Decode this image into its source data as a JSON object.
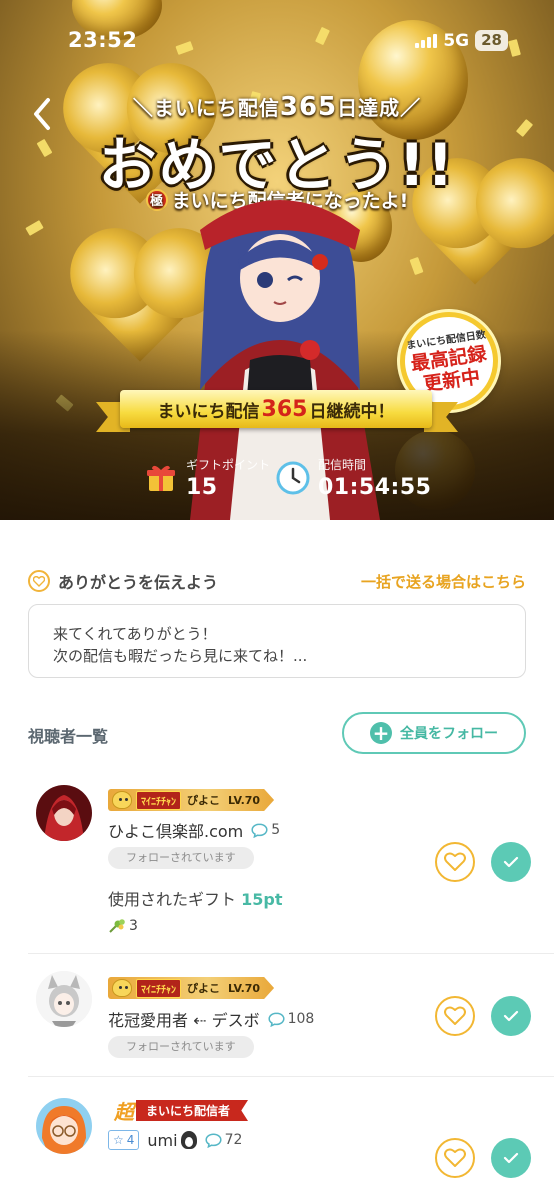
{
  "status_bar": {
    "time": "23:52",
    "network": "5G",
    "battery": "28"
  },
  "hero": {
    "top_line_prefix": "＼まいにち配信",
    "top_line_number": "365",
    "top_line_suffix": "日達成／",
    "title": "おめでとう!!",
    "subtitle_badge": "極",
    "subtitle": "極まいにち配信者になったよ!",
    "record_badge": {
      "small": "まいにち配信日数",
      "line1": "最高記録",
      "line2": "更新中"
    },
    "ribbon": {
      "prefix": "まいにち配信",
      "number": "365",
      "suffix": "日継続中！"
    },
    "gift_points": {
      "label": "ギフトポイント",
      "value": "15"
    },
    "stream_time": {
      "label": "配信時間",
      "value": "01:54:55"
    }
  },
  "thanks": {
    "title": "ありがとうを伝えよう",
    "bulk_link": "一括で送る場合はこちら",
    "message_line1": "来てくれてありがとう！",
    "message_line2": "次の配信も暇だったら見に来てね！..."
  },
  "viewers": {
    "title": "視聴者一覧",
    "follow_all_label": "全員をフォロー",
    "items": [
      {
        "badge_tag": "ﾏｲﾆﾁﾁｬﾝ",
        "badge_name": "ぴよこ",
        "badge_level": "LV.70",
        "name": "ひよこ倶楽部.com",
        "comments": "5",
        "follow_status": "フォローされています",
        "gift_label": "使用されたギフト",
        "gift_points": "15pt",
        "gift_count": "3"
      },
      {
        "badge_tag": "ﾏｲﾆﾁﾁｬﾝ",
        "badge_name": "ぴよこ",
        "badge_level": "LV.70",
        "name": "花冠愛用者 ⇠ デスボ",
        "comments": "108",
        "follow_status": "フォローされています"
      },
      {
        "super_mark": "超",
        "daily_tag": "まいにち配信者",
        "star_level": "4",
        "name": "umi",
        "comments": "72"
      }
    ]
  },
  "colors": {
    "accent_teal": "#5ccab5",
    "accent_orange": "#e8a421",
    "like_border": "#f2b733"
  }
}
